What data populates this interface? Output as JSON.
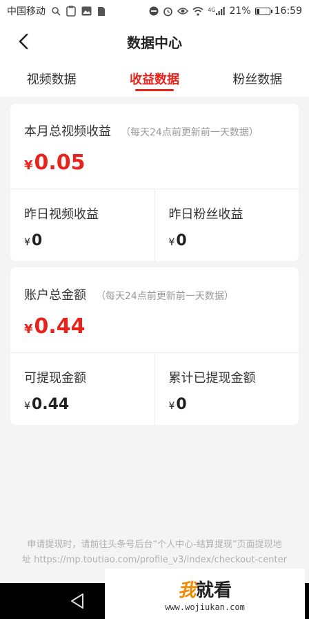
{
  "status_bar": {
    "carrier": "中国移动",
    "signal_label": "4G",
    "battery": "21%",
    "time": "16:59"
  },
  "header": {
    "title": "数据中心"
  },
  "tabs": [
    {
      "label": "视频数据",
      "active": false
    },
    {
      "label": "收益数据",
      "active": true
    },
    {
      "label": "粉丝数据",
      "active": false
    }
  ],
  "monthly": {
    "title": "本月总视频收益",
    "note": "（每天24点前更新前一天数据）",
    "currency": "¥",
    "amount": "0.05",
    "left": {
      "label": "昨日视频收益",
      "currency": "¥",
      "value": "0"
    },
    "right": {
      "label": "昨日粉丝收益",
      "currency": "¥",
      "value": "0"
    }
  },
  "account": {
    "title": "账户总金额",
    "note": "（每天24点前更新前一天数据）",
    "currency": "¥",
    "amount": "0.44",
    "left": {
      "label": "可提现金额",
      "currency": "¥",
      "value": "0.44"
    },
    "right": {
      "label": "累计已提现金额",
      "currency": "¥",
      "value": "0"
    }
  },
  "footer": {
    "line1": "申请提现时，请前往头条号后台“个人中心-结算提现”页面提现地",
    "line2": "址 https://mp.toutiao.com/profile_v3/index/checkout-center"
  },
  "watermark": {
    "char1": "我",
    "chars": "就看",
    "url": "www.wojiukan.com"
  },
  "colors": {
    "accent": "#e8231b",
    "background": "#f4f4f4"
  }
}
